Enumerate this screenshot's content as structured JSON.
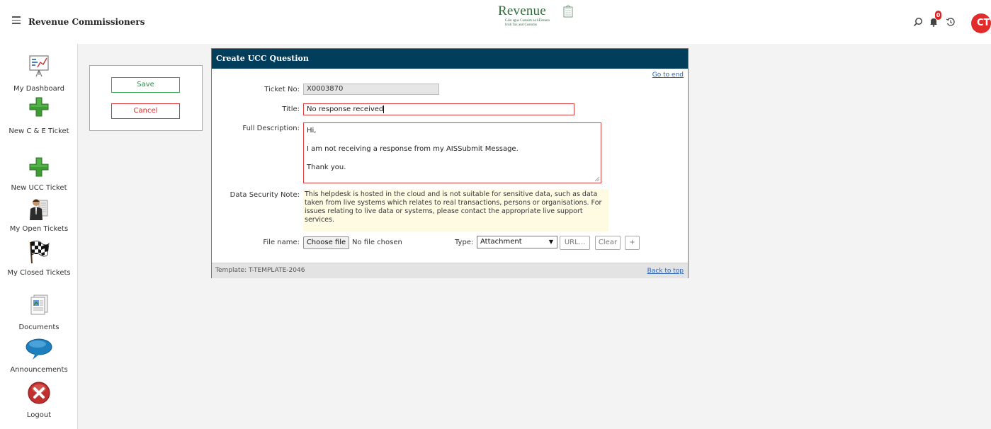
{
  "header": {
    "menu_icon": "hamburger-icon",
    "title": "Revenue Commissioners",
    "logo": {
      "word": "Revenue",
      "subtitle_ga": "Cáin agus Custaim na hÉireann",
      "subtitle_en": "Irish Tax and Customs"
    },
    "notification_count": "0",
    "user_initials": "CT"
  },
  "sidebar": {
    "items": [
      {
        "label": "My Dashboard",
        "icon": "dashboard-chart-icon"
      },
      {
        "label": "New C & E Ticket",
        "icon": "green-plus-icon"
      },
      {
        "label": "New UCC Ticket",
        "icon": "green-plus-icon"
      },
      {
        "label": "My Open Tickets",
        "icon": "person-documents-icon"
      },
      {
        "label": "My Closed Tickets",
        "icon": "checkered-flag-icon"
      },
      {
        "label": "Documents",
        "icon": "documents-icon"
      },
      {
        "label": "Announcements",
        "icon": "speech-bubble-icon"
      },
      {
        "label": "Logout",
        "icon": "logout-icon"
      }
    ]
  },
  "actions": {
    "save_label": "Save",
    "cancel_label": "Cancel"
  },
  "form": {
    "heading": "Create UCC Question",
    "go_to_end": "Go to end",
    "ticket_no_label": "Ticket No:",
    "ticket_no_value": "X0003870",
    "title_label": "Title:",
    "title_value": "No response received",
    "full_description_label": "Full Description:",
    "description_lines": [
      "Hi,",
      "I am not receiving a response from my AISSubmit Message.",
      "Thank you."
    ],
    "data_security_label": "Data Security Note:",
    "data_security_text": "This helpdesk is hosted in the cloud and is not suitable for sensitive data, such as data taken from live systems which relates to real transactions, persons or organisations. For issues relating to live data or systems, please contact the appropriate live support services.",
    "file_name_label": "File name:",
    "choose_file_label": "Choose file",
    "no_file_text": "No file chosen",
    "type_label": "Type:",
    "type_selected": "Attachment",
    "url_button": "URL...",
    "clear_button": "Clear",
    "add_button": "+",
    "template_text": "Template: T-TEMPLATE-2046",
    "back_to_top": "Back to top"
  },
  "colors": {
    "header_bar": "#003e5c",
    "avatar": "#e22b2b",
    "save_border": "#34a853",
    "cancel_border": "#e03030",
    "note_background": "#fffbe3"
  }
}
